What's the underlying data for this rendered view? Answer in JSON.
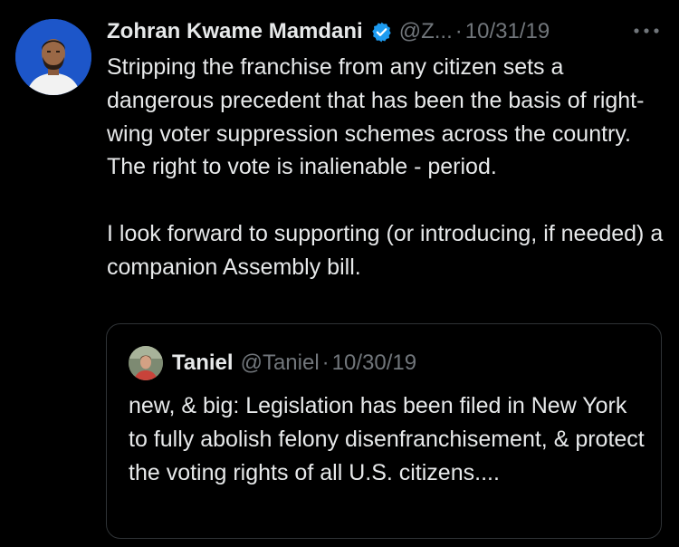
{
  "tweet": {
    "author_name": "Zohran Kwame Mamdani",
    "handle": "@Z...",
    "separator": "·",
    "date": "10/31/19",
    "text": "Stripping the franchise from any citizen sets a dangerous precedent that has been the basis of right-wing voter suppression schemes across the country. The right to vote is inalienable - period.\n\nI look forward to supporting (or introducing, if needed) a companion Assembly bill.",
    "verified_badge_color": "#1d9bf0",
    "avatar_background": "#1d56c9"
  },
  "quoted_tweet": {
    "author_name": "Taniel",
    "handle": "@Taniel",
    "separator": "·",
    "date": "10/30/19",
    "text": "new, & big: Legislation has been filed in New York to fully abolish felony disenfranchisement, & protect the voting rights of all U.S. citizens...."
  },
  "icons": {
    "verified": "verified-badge-icon",
    "more": "more-options-icon"
  },
  "colors": {
    "background": "#000000",
    "text_primary": "#e7e9ea",
    "text_secondary": "#71767b",
    "border": "#2f3336"
  }
}
